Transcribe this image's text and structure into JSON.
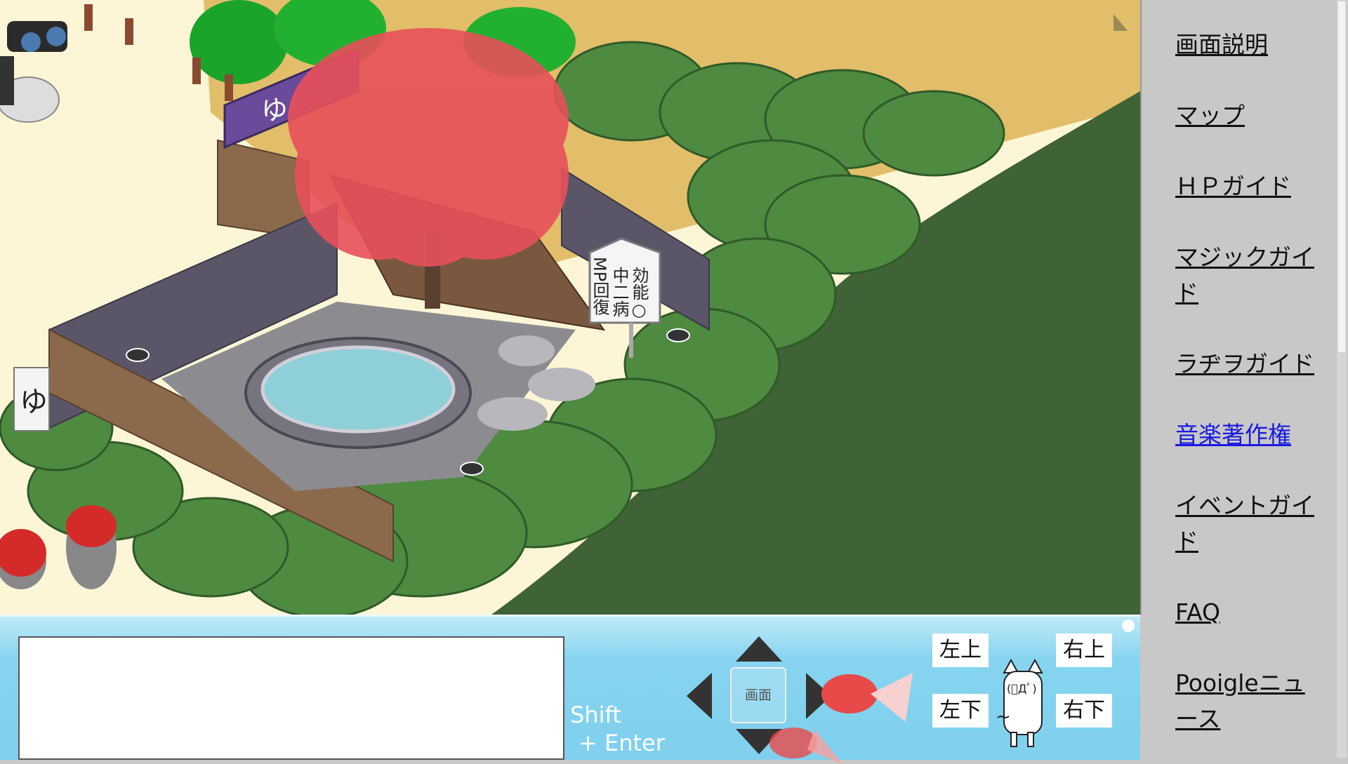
{
  "game": {
    "sign_lines": [
      "効能○",
      "中二病",
      "MP回復"
    ],
    "banner_char": "ゆ",
    "side_sign_char": "ゆ"
  },
  "sidebar": {
    "links": [
      {
        "label": "画面説明",
        "visited": false
      },
      {
        "label": "マップ",
        "visited": false
      },
      {
        "label": "ＨＰガイド",
        "visited": false
      },
      {
        "label": "マジックガイド",
        "visited": false
      },
      {
        "label": "ラヂヲガイド",
        "visited": false
      },
      {
        "label": "音楽著作権",
        "visited": true
      },
      {
        "label": "イベントガイド",
        "visited": false
      },
      {
        "label": "FAQ",
        "visited": false
      },
      {
        "label": "Pooigleニュース",
        "visited": false
      }
    ]
  },
  "controls": {
    "chat_value": "",
    "shift_line1": "Shift",
    "shift_line2": "+ Enter",
    "screen_label": "画面",
    "dir": {
      "up_left": "左上",
      "up_right": "右上",
      "down_left": "左下",
      "down_right": "右下"
    },
    "mascot_face": "(ﾟДﾟ)",
    "mascot_tilde": "~"
  },
  "colors": {
    "hill_dark": "#3f6336",
    "bush": "#4e8a40",
    "sky": "#e2be6a",
    "sakura": "#e8505a",
    "water": "#8ecfd8",
    "panel": "#7fd0ee",
    "link_visited": "#1a1ae0"
  },
  "icons": [
    "arrow-up-icon",
    "arrow-down-icon",
    "arrow-left-icon",
    "arrow-right-icon",
    "goldfish-icon",
    "cat-mascot-icon"
  ]
}
